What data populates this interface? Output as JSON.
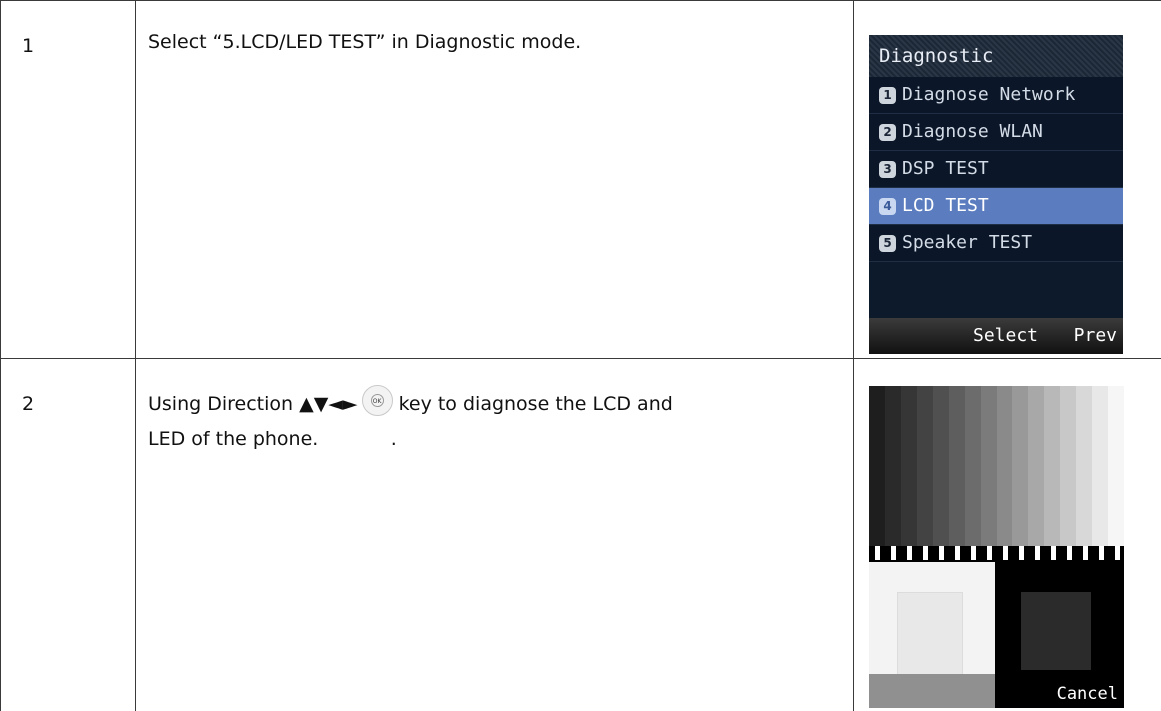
{
  "rows": [
    {
      "step": "1",
      "text": "Select “5.LCD/LED TEST” in Diagnostic mode."
    },
    {
      "step": "2",
      "text_part1": "Using Direction ▲▼◄►",
      "key_label": "OK",
      "text_part2": "key to diagnose the LCD and",
      "text_line2": "LED of the phone.            ."
    }
  ],
  "phone_menu": {
    "title": "Diagnostic",
    "items": [
      {
        "num": "1",
        "label": "Diagnose Network"
      },
      {
        "num": "2",
        "label": "Diagnose WLAN"
      },
      {
        "num": "3",
        "label": "DSP TEST"
      },
      {
        "num": "4",
        "label": "LCD TEST",
        "selected": true
      },
      {
        "num": "5",
        "label": "Speaker TEST"
      }
    ],
    "softkey_select": "Select",
    "softkey_prev": "Prev"
  },
  "lcd_test": {
    "cancel_label": "Cancel"
  },
  "colors": {
    "table_border": "#3a3a3a",
    "menu_highlight": "#5b7dbf",
    "menu_bg": "#0b1729"
  }
}
